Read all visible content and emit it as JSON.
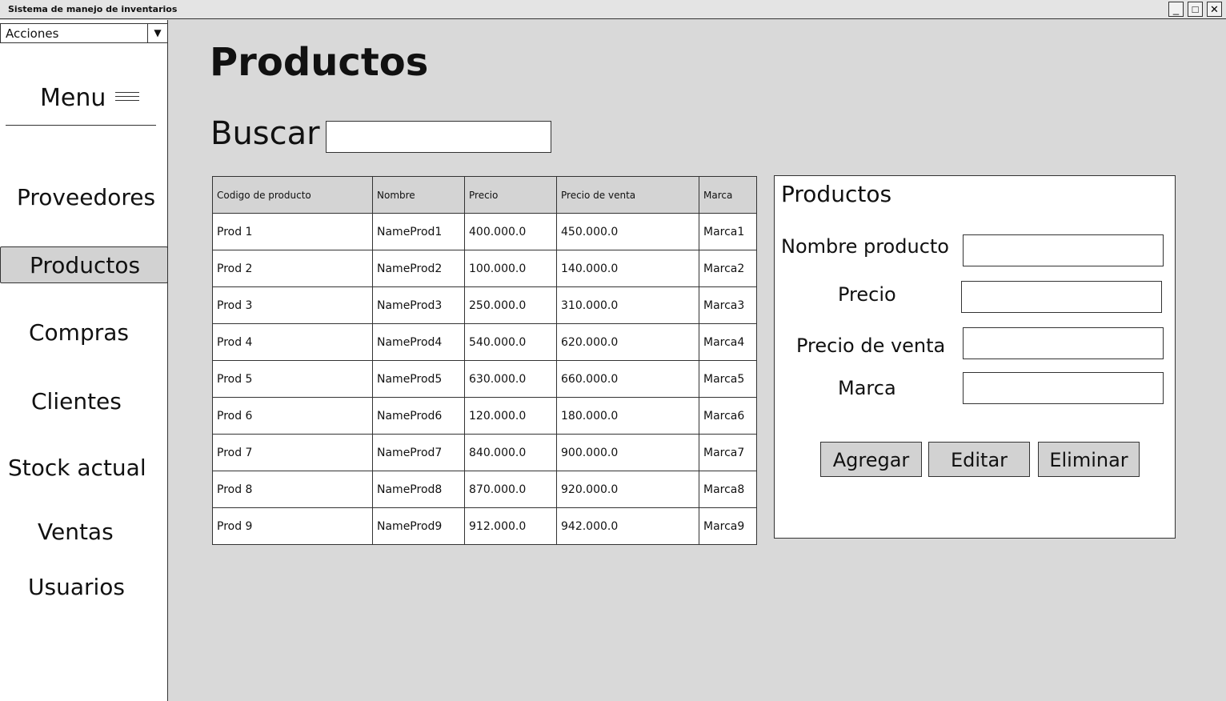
{
  "window": {
    "title": "Sistema de manejo de inventarios",
    "minimize_glyph": "_",
    "maximize_glyph": "□",
    "close_glyph": "✕"
  },
  "sidebar": {
    "actions_select": "Acciones",
    "menu_label": "Menu",
    "items": [
      {
        "label": "Proveedores"
      },
      {
        "label": "Productos",
        "active": true
      },
      {
        "label": "Compras"
      },
      {
        "label": "Clientes"
      },
      {
        "label": "Stock actual"
      },
      {
        "label": "Ventas"
      },
      {
        "label": "Usuarios"
      }
    ]
  },
  "main": {
    "title": "Productos",
    "search_label": "Buscar",
    "search_value": ""
  },
  "table": {
    "headers": [
      "Codigo de producto",
      "Nombre",
      "Precio",
      "Precio de venta",
      "Marca"
    ],
    "rows": [
      [
        "Prod 1",
        "NameProd1",
        "400.000.0",
        "450.000.0",
        "Marca1"
      ],
      [
        "Prod 2",
        "NameProd2",
        "100.000.0",
        "140.000.0",
        "Marca2"
      ],
      [
        "Prod 3",
        "NameProd3",
        "250.000.0",
        "310.000.0",
        "Marca3"
      ],
      [
        "Prod 4",
        "NameProd4",
        "540.000.0",
        "620.000.0",
        "Marca4"
      ],
      [
        "Prod 5",
        "NameProd5",
        "630.000.0",
        "660.000.0",
        "Marca5"
      ],
      [
        "Prod 6",
        "NameProd6",
        "120.000.0",
        "180.000.0",
        "Marca6"
      ],
      [
        "Prod 7",
        "NameProd7",
        "840.000.0",
        "900.000.0",
        "Marca7"
      ],
      [
        "Prod 8",
        "NameProd8",
        "870.000.0",
        "920.000.0",
        "Marca8"
      ],
      [
        "Prod 9",
        "NameProd9",
        "912.000.0",
        "942.000.0",
        "Marca9"
      ]
    ]
  },
  "form": {
    "title": "Productos",
    "fields": {
      "nombre": "Nombre producto",
      "precio": "Precio",
      "precio_venta": "Precio de venta",
      "marca": "Marca"
    },
    "buttons": {
      "add": "Agregar",
      "edit": "Editar",
      "delete": "Eliminar"
    }
  }
}
